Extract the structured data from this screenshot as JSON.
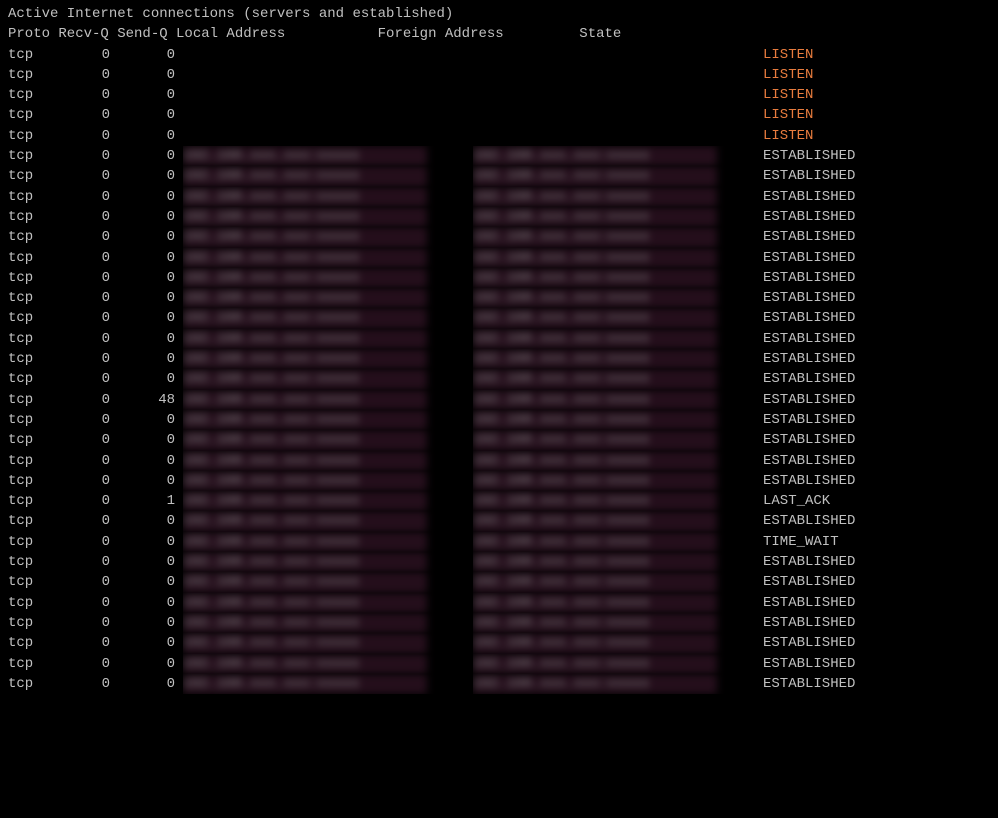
{
  "terminal": {
    "title": "Active Internet connections (servers and established)",
    "header": "Proto Recv-Q Send-Q Local Address           Foreign Address         State",
    "rows": [
      {
        "proto": "tcp",
        "recv": "0",
        "send": "0",
        "local": "",
        "foreign": "",
        "state": "LISTEN",
        "state_class": "state-listen",
        "blur_local": false,
        "blur_foreign": false
      },
      {
        "proto": "tcp",
        "recv": "0",
        "send": "0",
        "local": "",
        "foreign": "",
        "state": "LISTEN",
        "state_class": "state-listen",
        "blur_local": false,
        "blur_foreign": false
      },
      {
        "proto": "tcp",
        "recv": "0",
        "send": "0",
        "local": "",
        "foreign": "",
        "state": "LISTEN",
        "state_class": "state-listen",
        "blur_local": false,
        "blur_foreign": false
      },
      {
        "proto": "tcp",
        "recv": "0",
        "send": "0",
        "local": "",
        "foreign": "",
        "state": "LISTEN",
        "state_class": "state-listen",
        "blur_local": false,
        "blur_foreign": false
      },
      {
        "proto": "tcp",
        "recv": "0",
        "send": "0",
        "local": "",
        "foreign": "",
        "state": "LISTEN",
        "state_class": "state-listen",
        "blur_local": false,
        "blur_foreign": false
      },
      {
        "proto": "tcp",
        "recv": "0",
        "send": "0",
        "local": "xxx.xxx.xxx:xxxxx",
        "foreign": "xxx.xxx.xxx:xxxxx",
        "state": "ESTABLISHED",
        "state_class": "state-established",
        "blur_local": true,
        "blur_foreign": true
      },
      {
        "proto": "tcp",
        "recv": "0",
        "send": "0",
        "local": "xxx.xxx.xxx:xxxxx",
        "foreign": "xxx.xxx.xxx:xxxxx",
        "state": "ESTABLISHED",
        "state_class": "state-established",
        "blur_local": true,
        "blur_foreign": true
      },
      {
        "proto": "tcp",
        "recv": "0",
        "send": "0",
        "local": "xxx.xxx.xxx:xxxxx",
        "foreign": "xxx.xxx.xxx:xxxxx",
        "state": "ESTABLISHED",
        "state_class": "state-established",
        "blur_local": true,
        "blur_foreign": true
      },
      {
        "proto": "tcp",
        "recv": "0",
        "send": "0",
        "local": "xxx.xxx.xxx:xxxxx",
        "foreign": "xxx.xxx.xxx:xxxxx",
        "state": "ESTABLISHED",
        "state_class": "state-established",
        "blur_local": true,
        "blur_foreign": true
      },
      {
        "proto": "tcp",
        "recv": "0",
        "send": "0",
        "local": "xxx.xxx.xxx:xxxxx",
        "foreign": "xxx.xxx.xxx:xxxxx",
        "state": "ESTABLISHED",
        "state_class": "state-established",
        "blur_local": true,
        "blur_foreign": true
      },
      {
        "proto": "tcp",
        "recv": "0",
        "send": "0",
        "local": "xxx.xxx.xxx:xxxxx",
        "foreign": "xxx.xxx.xxx:xxxxx",
        "state": "ESTABLISHED",
        "state_class": "state-established",
        "blur_local": true,
        "blur_foreign": true
      },
      {
        "proto": "tcp",
        "recv": "0",
        "send": "0",
        "local": "xxx.xxx.xxx:xxxxx",
        "foreign": "xxx.xxx.xxx:xxxxx",
        "state": "ESTABLISHED",
        "state_class": "state-established",
        "blur_local": true,
        "blur_foreign": true
      },
      {
        "proto": "tcp",
        "recv": "0",
        "send": "0",
        "local": "xxx.xxx.xxx:xxxxx",
        "foreign": "xxx.xxx.xxx:xxxxx",
        "state": "ESTABLISHED",
        "state_class": "state-established",
        "blur_local": true,
        "blur_foreign": true
      },
      {
        "proto": "tcp",
        "recv": "0",
        "send": "0",
        "local": "xxx.xxx.xxx:xxxxx",
        "foreign": "xxx.xxx.xxx:xxxxx",
        "state": "ESTABLISHED",
        "state_class": "state-established",
        "blur_local": true,
        "blur_foreign": true
      },
      {
        "proto": "tcp",
        "recv": "0",
        "send": "0",
        "local": "xxx.xxx.xxx:xxxxx",
        "foreign": "xxx.xxx.xxx:xxxxx",
        "state": "ESTABLISHED",
        "state_class": "state-established",
        "blur_local": true,
        "blur_foreign": true
      },
      {
        "proto": "tcp",
        "recv": "0",
        "send": "0",
        "local": "xxx.xxx.xxx:xxxxx",
        "foreign": "xxx.xxx.xxx:xxxxx",
        "state": "ESTABLISHED",
        "state_class": "state-established",
        "blur_local": true,
        "blur_foreign": true
      },
      {
        "proto": "tcp",
        "recv": "0",
        "send": "0",
        "local": "xxx.xxx.xxx:xxxxx",
        "foreign": "xxx.xxx.xxx:xxxxx",
        "state": "ESTABLISHED",
        "state_class": "state-established",
        "blur_local": true,
        "blur_foreign": true
      },
      {
        "proto": "tcp",
        "recv": "0",
        "send": "48",
        "local": "xxx.xxx.xxx:xxxxx",
        "foreign": "xxx.xxx.xxx:xxxxx",
        "state": "ESTABLISHED",
        "state_class": "state-established",
        "blur_local": true,
        "blur_foreign": true
      },
      {
        "proto": "tcp",
        "recv": "0",
        "send": "0",
        "local": "xxx.xxx.xxx:xxxxx",
        "foreign": "xxx.xxx.xxx:xxxxx",
        "state": "ESTABLISHED",
        "state_class": "state-established",
        "blur_local": true,
        "blur_foreign": true
      },
      {
        "proto": "tcp",
        "recv": "0",
        "send": "0",
        "local": "xxx.xxx.xxx:xxxxx",
        "foreign": "xxx.xxx.xxx:xxxxx",
        "state": "ESTABLISHED",
        "state_class": "state-established",
        "blur_local": true,
        "blur_foreign": true
      },
      {
        "proto": "tcp",
        "recv": "0",
        "send": "0",
        "local": "xxx.xxx.xxx:xxxxx",
        "foreign": "xxx.xxx.xxx:xxxxx",
        "state": "ESTABLISHED",
        "state_class": "state-established",
        "blur_local": true,
        "blur_foreign": true
      },
      {
        "proto": "tcp",
        "recv": "0",
        "send": "0",
        "local": "xxx.xxx.xxx:xxxxx",
        "foreign": "xxx.xxx.xxx:xxxxx",
        "state": "ESTABLISHED",
        "state_class": "state-established",
        "blur_local": true,
        "blur_foreign": true
      },
      {
        "proto": "tcp",
        "recv": "0",
        "send": "1",
        "local": "xxx.xxx.xxx:xxxxx",
        "foreign": "xxx.xxx.xxx:xxxxx",
        "state": "LAST_ACK",
        "state_class": "state-last-ack",
        "blur_local": true,
        "blur_foreign": true
      },
      {
        "proto": "tcp",
        "recv": "0",
        "send": "0",
        "local": "xxx.xxx.xxx:xxxxx",
        "foreign": "xxx.xxx.xxx:xxxxx",
        "state": "ESTABLISHED",
        "state_class": "state-established",
        "blur_local": true,
        "blur_foreign": true
      },
      {
        "proto": "tcp",
        "recv": "0",
        "send": "0",
        "local": "xxx.xxx.xxx:xxxxx",
        "foreign": "xxx.xxx.xxx:xxxxx",
        "state": "TIME_WAIT",
        "state_class": "state-time-wait",
        "blur_local": true,
        "blur_foreign": true
      },
      {
        "proto": "tcp",
        "recv": "0",
        "send": "0",
        "local": "xxx.xxx.xxx:xxxxx",
        "foreign": "xxx.xxx.xxx:xxxxx",
        "state": "ESTABLISHED",
        "state_class": "state-established",
        "blur_local": true,
        "blur_foreign": true
      },
      {
        "proto": "tcp",
        "recv": "0",
        "send": "0",
        "local": "xxx.xxx.xxx:xxxxx",
        "foreign": "xxx.xxx.xxx:xxxxx",
        "state": "ESTABLISHED",
        "state_class": "state-established",
        "blur_local": true,
        "blur_foreign": true
      },
      {
        "proto": "tcp",
        "recv": "0",
        "send": "0",
        "local": "xxx.xxx.xxx:xxxxx",
        "foreign": "xxx.xxx.xxx:xxxxx",
        "state": "ESTABLISHED",
        "state_class": "state-established",
        "blur_local": true,
        "blur_foreign": true
      },
      {
        "proto": "tcp",
        "recv": "0",
        "send": "0",
        "local": "xxx.xxx.xxx:xxxxx",
        "foreign": "xxx.xxx.xxx:xxxxx",
        "state": "ESTABLISHED",
        "state_class": "state-established",
        "blur_local": true,
        "blur_foreign": true
      },
      {
        "proto": "tcp",
        "recv": "0",
        "send": "0",
        "local": "xxx.xxx.xxx:xxxxx",
        "foreign": "xxx.xxx.xxx:xxxxx",
        "state": "ESTABLISHED",
        "state_class": "state-established",
        "blur_local": true,
        "blur_foreign": true
      },
      {
        "proto": "tcp",
        "recv": "0",
        "send": "0",
        "local": "xxx.xxx.xxx:xxxxx",
        "foreign": "xxx.xxx.xxx:xxxxx",
        "state": "ESTABLISHED",
        "state_class": "state-established",
        "blur_local": true,
        "blur_foreign": true
      },
      {
        "proto": "tcp",
        "recv": "0",
        "send": "0",
        "local": "xxx.xxx.xxx:xxxxx",
        "foreign": "xxx.xxx.xxx:xxxxx",
        "state": "ESTABLISHED",
        "state_class": "state-established",
        "blur_local": true,
        "blur_foreign": true
      }
    ]
  }
}
